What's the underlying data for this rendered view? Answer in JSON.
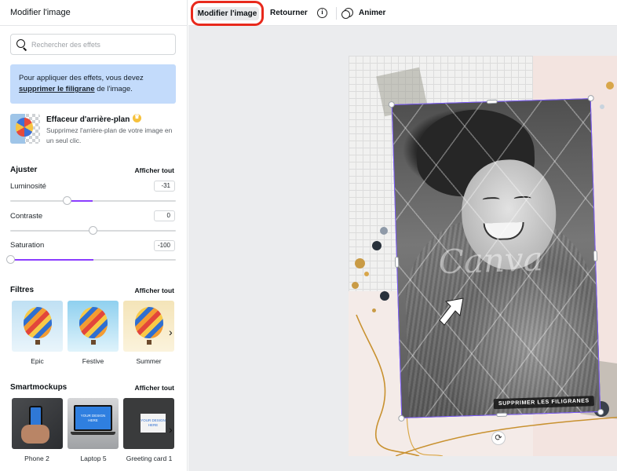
{
  "panel": {
    "title": "Modifier l'image",
    "search_placeholder": "Rechercher des effets",
    "notice": {
      "text_before": "Pour appliquer des effets, vous devez ",
      "link": "supprimer le filigrane",
      "text_after": " de l'image."
    },
    "bg_remover": {
      "title": "Effaceur d'arrière-plan",
      "description": "Supprimez l'arrière-plan de votre image en un seul clic."
    },
    "adjust": {
      "heading": "Ajuster",
      "see_all": "Afficher tout",
      "sliders": [
        {
          "label": "Luminosité",
          "value": "-31",
          "fraction": 0.345
        },
        {
          "label": "Contraste",
          "value": "0",
          "fraction": 0.5
        },
        {
          "label": "Saturation",
          "value": "-100",
          "fraction": 0.0
        }
      ]
    },
    "filters": {
      "heading": "Filtres",
      "see_all": "Afficher tout",
      "items": [
        {
          "label": "Epic"
        },
        {
          "label": "Festive"
        },
        {
          "label": "Summer"
        }
      ]
    },
    "smartmockups": {
      "heading": "Smartmockups",
      "see_all": "Afficher tout",
      "items": [
        {
          "label": "Phone 2"
        },
        {
          "label": "Laptop 5"
        },
        {
          "label": "Greeting card 1"
        }
      ],
      "laptop_screen_text": "YOUR DESIGN HERE",
      "card_text": "YOUR DESIGN HERE"
    }
  },
  "toolbar": {
    "edit_image": "Modifier l'image",
    "flip": "Retourner",
    "info_glyph": "i",
    "animate": "Animer"
  },
  "canvas": {
    "watermark_text": "Canva",
    "remove_watermark": "SUPPRIMER LES FILIGRANES",
    "rotate_glyph": "⟳"
  },
  "colors": {
    "accent_purple": "#8b3dff",
    "highlight_red": "#e8291c",
    "notice_blue": "#c3dbfb"
  }
}
